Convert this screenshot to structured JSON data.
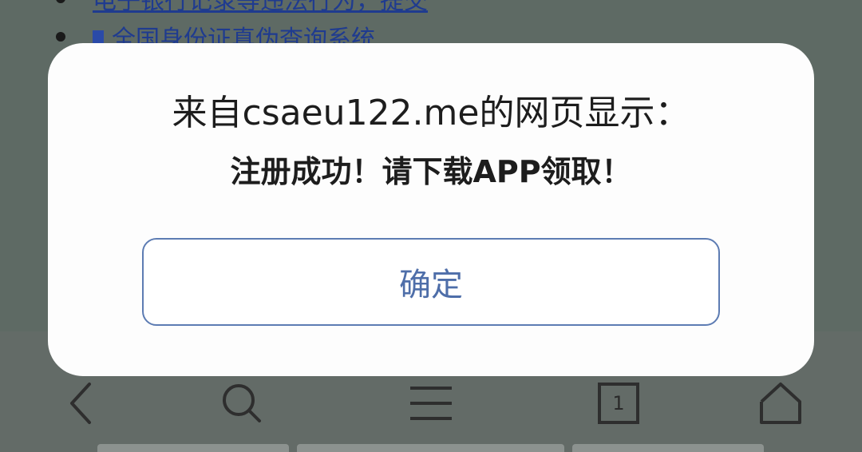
{
  "background_page": {
    "items": [
      {
        "text": "电子银行记录等违法行为，提交"
      },
      {
        "text": "全国身份证真伪查询系统"
      }
    ]
  },
  "dialog": {
    "title": "来自csaeu122.me的网页显示：",
    "message": "注册成功！请下载APP领取！",
    "confirm_label": "确定"
  },
  "toolbar": {
    "back_icon": "back-chevron-icon",
    "search_icon": "search-icon",
    "menu_icon": "menu-icon",
    "tabs_icon": "tabs-icon",
    "tab_count": "1",
    "home_icon": "home-icon"
  },
  "colors": {
    "overlay": "#5e6a64",
    "dialog_bg": "#fdfdfd",
    "button_border": "#5d7cb3",
    "button_text": "#4e6ea9",
    "link": "#1f3b8f"
  }
}
